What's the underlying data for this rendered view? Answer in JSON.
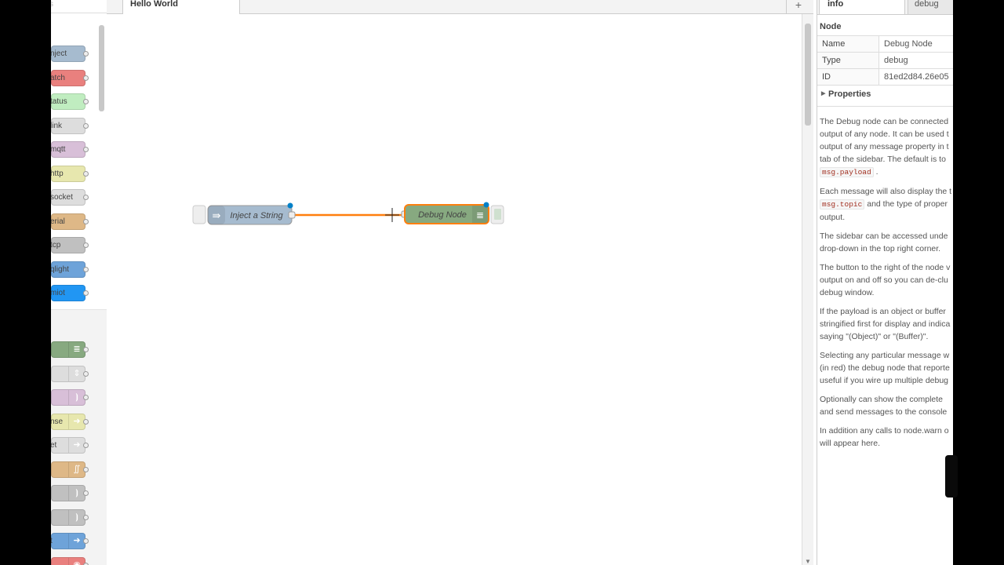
{
  "palette": {
    "search_hint": "s",
    "top_nodes": [
      {
        "label": "nject",
        "color": "#a6bbcf"
      },
      {
        "label": "atch",
        "color": "#e9807e"
      },
      {
        "label": "tatus",
        "color": "#c0edc0"
      },
      {
        "label": "link",
        "color": "#dddddd"
      },
      {
        "label": "mqtt",
        "color": "#d8bfd8"
      },
      {
        "label": "http",
        "color": "#e7e7ae"
      },
      {
        "label": "socket",
        "color": "#dddddd"
      },
      {
        "label": "erial",
        "color": "#deb887"
      },
      {
        "label": "tcp",
        "color": "#c0c0c0"
      },
      {
        "label": "qlight",
        "color": "#6ea3d9"
      },
      {
        "label": "miot",
        "color": "#2196f3"
      }
    ],
    "bottom_nodes": [
      {
        "label": "",
        "color": "#87a980",
        "icon": "≣"
      },
      {
        "label": "",
        "color": "#dddddd",
        "icon": "⇕"
      },
      {
        "label": "",
        "color": "#d8bfd8",
        "icon": "⦘"
      },
      {
        "label": "nse",
        "color": "#e7e7ae",
        "icon": "➜"
      },
      {
        "label": "et",
        "color": "#dddddd",
        "icon": "➜"
      },
      {
        "label": "",
        "color": "#deb887",
        "icon": "∬"
      },
      {
        "label": "",
        "color": "#c0c0c0",
        "icon": "⦘"
      },
      {
        "label": "",
        "color": "#c0c0c0",
        "icon": "⦘"
      },
      {
        "label": "t",
        "color": "#6ea3d9",
        "icon": "➜"
      },
      {
        "label": "",
        "color": "#e9807e",
        "icon": "◉"
      }
    ]
  },
  "workspace": {
    "tab_label": "Hello World",
    "add_tab_label": "+",
    "nodes": {
      "inject": {
        "label": "Inject a String",
        "color": "#a6bbcf",
        "icon": "⇛"
      },
      "debug": {
        "label": "Debug Node",
        "color": "#87a980",
        "icon": "≣",
        "selected_color": "#ff7f0e"
      }
    },
    "wire_color": "#ff7f0e"
  },
  "sidebar": {
    "tabs": {
      "info": "info",
      "debug": "debug"
    },
    "section_title": "Node",
    "rows": [
      {
        "key": "Name",
        "value": "Debug Node"
      },
      {
        "key": "Type",
        "value": "debug"
      },
      {
        "key": "ID",
        "value": "81ed2d84.26e05"
      }
    ],
    "properties_label": "Properties",
    "help": {
      "p1_l1": "The Debug node can be connected",
      "p1_l2": "output of any node. It can be used t",
      "p1_l3": "output of any message property in t",
      "p1_l4": "tab of the sidebar. The default is to",
      "p1_code": "msg.payload",
      "p2_l1": "Each message will also display the t",
      "p2_code": "msg.topic",
      "p2_l2b": "and the type of proper",
      "p2_l3": "output.",
      "p3_l1": "The sidebar can be accessed unde",
      "p3_l2": "drop-down in the top right corner.",
      "p4_l1": "The button to the right of the node v",
      "p4_l2": "output on and off so you can de-clu",
      "p4_l3": "debug window.",
      "p5_l1": "If the payload is an object or buffer",
      "p5_l2": "stringified first for display and indica",
      "p5_l3": "saying \"(Object)\" or \"(Buffer)\".",
      "p6_l1": "Selecting any particular message w",
      "p6_l2": "(in red) the debug node that reporte",
      "p6_l3": "useful if you wire up multiple debug",
      "p7_l1": "Optionally can show the complete",
      "p7_l2": "and send messages to the console",
      "p8_l1": "In addition any calls to node.warn o",
      "p8_l2": "will appear here."
    }
  }
}
